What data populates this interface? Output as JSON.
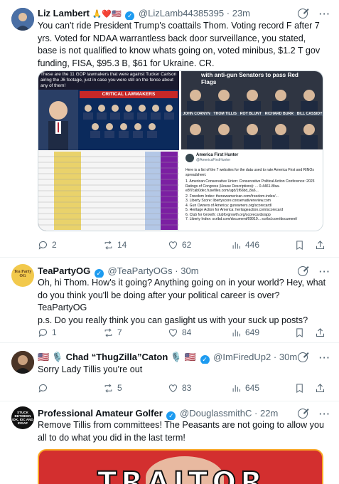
{
  "posts": [
    {
      "name": "Liz Lambert",
      "emojis": "🙏❤️🇺🇸",
      "handle": "@LizLamb44385395",
      "time": "23m",
      "text": "You can't ride President Trump's coattails Thom.  Voting record F after 7 yrs. Voted for NDAA warrantless back door surveillance, you stated, base is not qualified to know whats going on, voted minibus, $1.2 T gov funding, FISA, $95.3 B, $61 for Ukraine. CR.",
      "media": {
        "left_caption": "These are the 11 GOP lawmakers that were against Tucker Carlson airing the J6 footage, just in case you were still on the fence about any of them!",
        "critical_label": "CRITICAL LAWMAKERS",
        "right_top_caption": "with anti-gun Senators to pass Red Flags",
        "senators": [
          "JOHN CORNYN",
          "THOM TILLIS",
          "ROY BLUNT",
          "RICHARD BURR",
          "BILL CASSIDY"
        ],
        "embed_name": "America First Hunter",
        "embed_handle": "@AmericaFirstHunter",
        "embed_lines": [
          "Here is a list of the 7 websites for the data used to rate America First and RINOs spreadsheet.",
          "1. American Conservative Union: Conservative Political Action Conference: 2023 Ratings of Congress (House Descriptions): ... 0-4461-8faa-e8f7cab0dec.fusefiles.com/ugd/1f66bd_8a6...",
          "2. Freedom Index: thenewamerican.com/freedom-index/...",
          "3. Liberty Score: libertyscore.conservativereview.com",
          "4. Gun Owners of America: gunowners.org/scorecard/",
          "5. Heritage Action for America: heritageaction.com/scorecard",
          "6. Club for Growth: clubforgrowth.org/scorecards/app",
          "7. Liberty Index: scribd.com/document/69919... scribd.com/document/"
        ]
      },
      "replies": "2",
      "reposts": "14",
      "likes": "62",
      "views": "446"
    },
    {
      "name": "TeaPartyOG",
      "handle": "@TeaPartyOGs",
      "time": "30m",
      "text_lines": [
        "Oh, hi Thom. How's it going? Anything going on in your world? Hey, what do you think you'll be doing after your political career is over?",
        "TeaPartyOG",
        "p.s. Do you really think you can gaslight us with your suck up posts?"
      ],
      "avatar_text": "Tea Party OG",
      "replies": "1",
      "reposts": "7",
      "likes": "84",
      "views": "649"
    },
    {
      "name_prefix": "🇺🇸 🎙️ Chad “ThugZilla”Caton 🎙️ 🇺🇸",
      "handle": "@ImFiredUp2",
      "time": "30m",
      "text": "Sorry Lady Tillis you're out",
      "replies": "",
      "reposts": "5",
      "likes": "83",
      "views": "645"
    },
    {
      "name": "Professional Amateur Golfer",
      "handle": "@DouglassmithC",
      "time": "22m",
      "text": "Remove Tillis from committees! The Peasants are not going to allow you all to do what you did in the last term!",
      "avatar_text": "STUCK BETWEEN IDK, IDC AND IDGAF",
      "media_text": "TRAITOR"
    }
  ],
  "colors": {
    "accent": "#1d9bf0",
    "muted": "#536471",
    "border": "#cfd9de"
  },
  "icons": [
    "reply-icon",
    "repost-icon",
    "like-icon",
    "views-icon",
    "bookmark-icon",
    "share-icon",
    "grok-icon",
    "more-icon",
    "verified-badge-icon"
  ]
}
